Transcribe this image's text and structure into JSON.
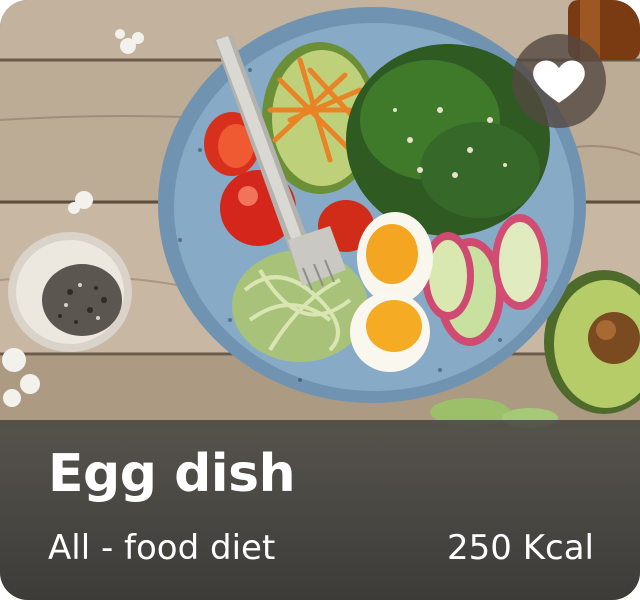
{
  "card": {
    "title": "Egg dish",
    "subtitle": "All - food diet",
    "calories": "250 Kcal",
    "favorite_icon": "heart-icon",
    "colors": {
      "overlay": "#3f3f3c",
      "text": "#ffffff",
      "favorite_bg": "#544842",
      "bowl": "#7fa4c0"
    }
  }
}
